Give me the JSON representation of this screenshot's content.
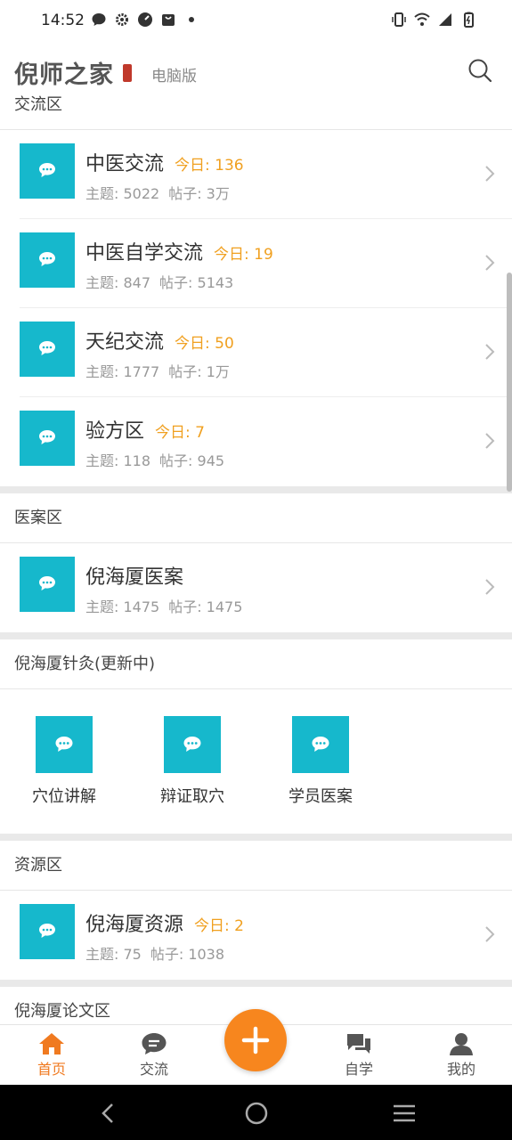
{
  "status": {
    "time": "14:52",
    "left_icons": [
      "chat-icon",
      "gear-icon",
      "speed-icon",
      "bag-icon",
      "dot-icon"
    ],
    "right_icons": [
      "vibrate-icon",
      "wifi-icon",
      "signal-icon",
      "battery-icon"
    ]
  },
  "header": {
    "logo": "倪师之家",
    "pc_link": "电脑版",
    "search_icon": "search-icon"
  },
  "sections": {
    "exchange": {
      "title": "交流区",
      "forums": [
        {
          "name": "中医交流",
          "today": "今日: 136",
          "topics": "主题: 5022",
          "posts": "帖子: 3万"
        },
        {
          "name": "中医自学交流",
          "today": "今日: 19",
          "topics": "主题: 847",
          "posts": "帖子: 5143"
        },
        {
          "name": "天纪交流",
          "today": "今日: 50",
          "topics": "主题: 1777",
          "posts": "帖子: 1万"
        },
        {
          "name": "验方区",
          "today": "今日: 7",
          "topics": "主题: 118",
          "posts": "帖子: 945"
        }
      ]
    },
    "cases": {
      "title": "医案区",
      "forums": [
        {
          "name": "倪海厦医案",
          "topics": "主题: 1475",
          "posts": "帖子: 1475"
        }
      ]
    },
    "acupuncture": {
      "title": "倪海厦针灸(更新中)",
      "items": [
        {
          "label": "穴位讲解"
        },
        {
          "label": "辩证取穴"
        },
        {
          "label": "学员医案"
        }
      ]
    },
    "resources": {
      "title": "资源区",
      "forums": [
        {
          "name": "倪海厦资源",
          "today": "今日: 2",
          "topics": "主题: 75",
          "posts": "帖子: 1038"
        }
      ]
    },
    "papers": {
      "title": "倪海厦论文区"
    }
  },
  "tabbar": {
    "home": "首页",
    "exchange": "交流",
    "study": "自学",
    "mine": "我的"
  },
  "colors": {
    "accent": "#f7861e",
    "forum_icon": "#16b8cc",
    "today": "#f0a020"
  }
}
